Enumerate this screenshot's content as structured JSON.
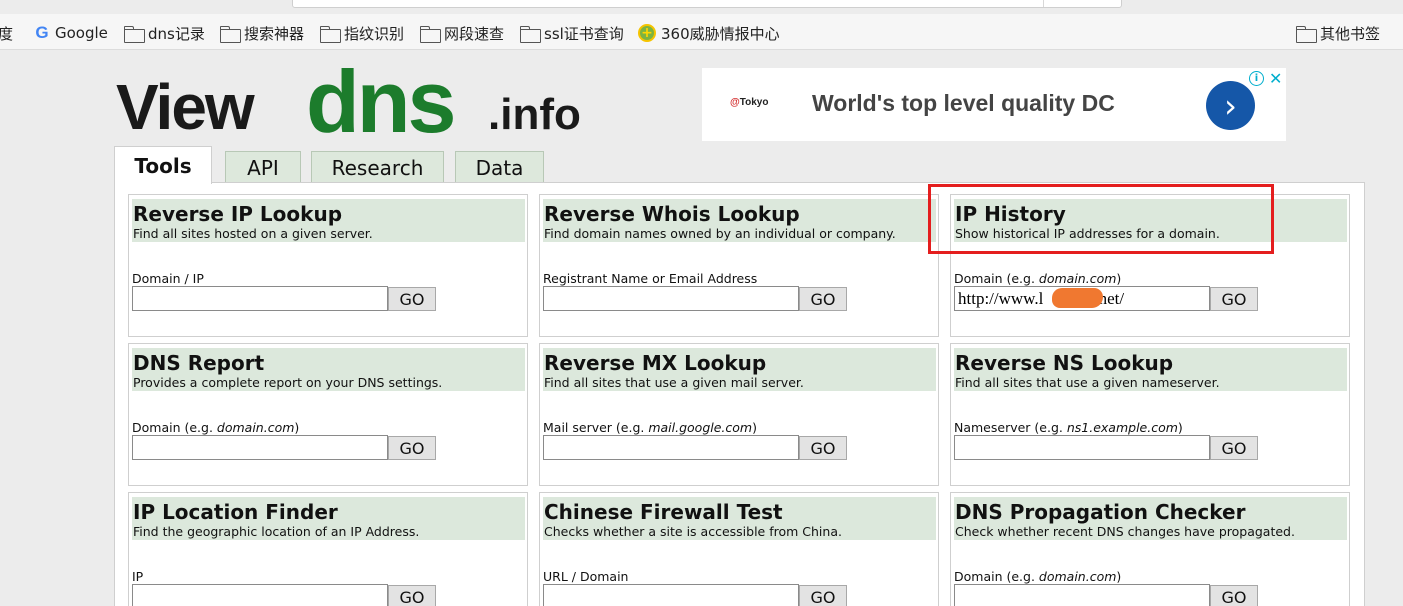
{
  "bookmarks": {
    "items": [
      {
        "label": "度",
        "icon": "none"
      },
      {
        "label": "Google",
        "icon": "google-icon"
      },
      {
        "label": "dns记录",
        "icon": "folder-icon"
      },
      {
        "label": "搜索神器",
        "icon": "folder-icon"
      },
      {
        "label": "指纹识别",
        "icon": "folder-icon"
      },
      {
        "label": "网段速查",
        "icon": "folder-icon"
      },
      {
        "label": "ssl证书查询",
        "icon": "folder-icon"
      },
      {
        "label": "360威胁情报中心",
        "icon": "threat-360-icon"
      }
    ],
    "other": {
      "label": "其他书签",
      "icon": "folder-icon"
    }
  },
  "logo": {
    "part1": "View",
    "part2": "dns",
    "part3": ".info"
  },
  "ad": {
    "brand_prefix": "@",
    "brand": "Tokyo",
    "headline": "World's top level quality DC",
    "arrow": "›",
    "info": "i",
    "close": "✕"
  },
  "tabs": [
    {
      "label": "Tools",
      "active": true
    },
    {
      "label": "API",
      "active": false
    },
    {
      "label": "Research",
      "active": false
    },
    {
      "label": "Data",
      "active": false
    }
  ],
  "tools": [
    {
      "title": "Reverse IP Lookup",
      "description": "Find all sites hosted on a given server.",
      "label": "Domain / IP",
      "label_example": "",
      "label_suffix": "",
      "value": "",
      "button": "GO"
    },
    {
      "title": "Reverse Whois Lookup",
      "description": "Find domain names owned by an individual or company.",
      "label": "Registrant Name or Email Address",
      "label_example": "",
      "label_suffix": "",
      "value": "",
      "button": "GO"
    },
    {
      "title": "IP History",
      "description": "Show historical IP addresses for a domain.",
      "label": "Domain (e.g. ",
      "label_example": "domain.com",
      "label_suffix": ")",
      "value": "http://www.l          o.net/",
      "button": "GO"
    },
    {
      "title": "DNS Report",
      "description": "Provides a complete report on your DNS settings.",
      "label": "Domain (e.g. ",
      "label_example": "domain.com",
      "label_suffix": ")",
      "value": "",
      "button": "GO"
    },
    {
      "title": "Reverse MX Lookup",
      "description": "Find all sites that use a given mail server.",
      "label": "Mail server (e.g. ",
      "label_example": "mail.google.com",
      "label_suffix": ")",
      "value": "",
      "button": "GO"
    },
    {
      "title": "Reverse NS Lookup",
      "description": "Find all sites that use a given nameserver.",
      "label": "Nameserver (e.g. ",
      "label_example": "ns1.example.com",
      "label_suffix": ")",
      "value": "",
      "button": "GO"
    },
    {
      "title": "IP Location Finder",
      "description": "Find the geographic location of an IP Address.",
      "label": "IP",
      "label_example": "",
      "label_suffix": "",
      "value": "",
      "button": "GO"
    },
    {
      "title": "Chinese Firewall Test",
      "description": "Checks whether a site is accessible from China.",
      "label": "URL / Domain",
      "label_example": "",
      "label_suffix": "",
      "value": "",
      "button": "GO"
    },
    {
      "title": "DNS Propagation Checker",
      "description": "Check whether recent DNS changes have propagated.",
      "label": "Domain (e.g. ",
      "label_example": "domain.com",
      "label_suffix": ")",
      "value": "",
      "button": "GO"
    }
  ],
  "colors": {
    "brand_green": "#1c7c2c",
    "tool_header_bg": "#dce8dc",
    "highlight_red": "#e41e1e",
    "ad_button_blue": "#1557a8"
  }
}
